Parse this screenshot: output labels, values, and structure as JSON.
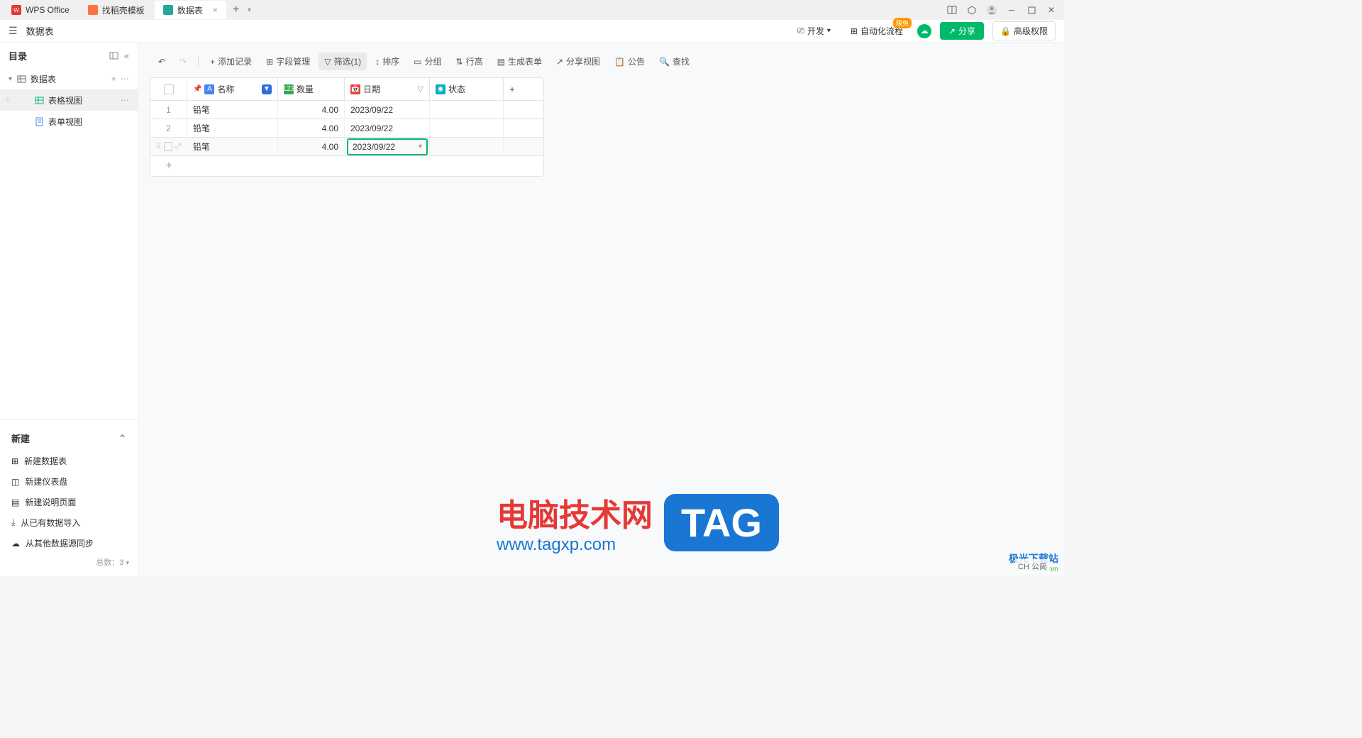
{
  "tabs": [
    {
      "label": "WPS Office",
      "icon_color": "#e53935"
    },
    {
      "label": "找稻壳模板",
      "icon_color": "#ff7043"
    },
    {
      "label": "数据表",
      "icon_color": "#26a69a",
      "active": true
    }
  ],
  "window": {
    "sub_title": "数据表",
    "dev_label": "开发",
    "automation_label": "自动化流程",
    "badge_free": "限免",
    "share_label": "分享",
    "perm_label": "高级权限"
  },
  "sidebar": {
    "catalog_title": "目录",
    "root": "数据表",
    "view_grid": "表格视图",
    "view_form": "表单视图",
    "new_title": "新建",
    "new_items": [
      "新建数据表",
      "新建仪表盘",
      "新建说明页面",
      "从已有数据导入",
      "从其他数据源同步"
    ],
    "footer": "总数：3"
  },
  "toolbar": {
    "add_record": "添加记录",
    "field_manage": "字段管理",
    "filter": "筛选(1)",
    "sort": "排序",
    "group": "分组",
    "row_height": "行高",
    "gen_form": "生成表单",
    "share_view": "分享视图",
    "announce": "公告",
    "search": "查找"
  },
  "columns": {
    "name": "名称",
    "quantity": "数量",
    "date": "日期",
    "status": "状态"
  },
  "rows": [
    {
      "idx": "1",
      "name": "铅笔",
      "qty": "4.00",
      "date": "2023/09/22"
    },
    {
      "idx": "2",
      "name": "铅笔",
      "qty": "4.00",
      "date": "2023/09/22"
    },
    {
      "idx": "",
      "name": "铅笔",
      "qty": "4.00",
      "date": "2023/09/22",
      "active": true
    }
  ],
  "watermark": {
    "cn": "电脑技术网",
    "url": "www.tagxp.com",
    "tag": "TAG",
    "corner_cn": "极光下载站",
    "corner_url": "www.xz7.com"
  },
  "ime": "CH 公简"
}
